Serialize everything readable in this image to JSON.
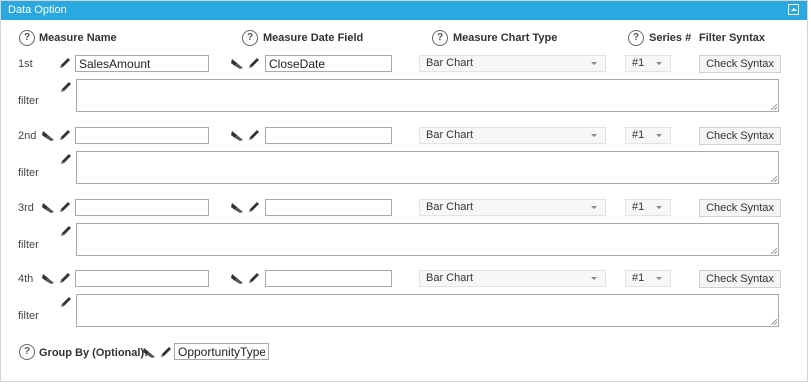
{
  "panel": {
    "title": "Data Option"
  },
  "columns": {
    "help": "?",
    "measure_name": "Measure Name",
    "measure_date_field": "Measure Date Field",
    "measure_chart_type": "Measure Chart Type",
    "series": "Series #",
    "filter_syntax": "Filter Syntax"
  },
  "filter_label": "filter",
  "rows": [
    {
      "ordinal": "1st",
      "measure_name": "SalesAmount",
      "date_field": "CloseDate",
      "chart_type": "Bar Chart",
      "series": "#1",
      "check_label": "Check Syntax"
    },
    {
      "ordinal": "2nd",
      "measure_name": "",
      "date_field": "",
      "chart_type": "Bar Chart",
      "series": "#1",
      "check_label": "Check Syntax"
    },
    {
      "ordinal": "3rd",
      "measure_name": "",
      "date_field": "",
      "chart_type": "Bar Chart",
      "series": "#1",
      "check_label": "Check Syntax"
    },
    {
      "ordinal": "4th",
      "measure_name": "",
      "date_field": "",
      "chart_type": "Bar Chart",
      "series": "#1",
      "check_label": "Check Syntax"
    }
  ],
  "group_by": {
    "label": "Group By (Optional):",
    "value": "OpportunityType"
  },
  "icons": {
    "help": "question-circle-icon",
    "edit": "pencil-icon",
    "clear": "eraser-icon",
    "maximize": "maximize-icon"
  }
}
